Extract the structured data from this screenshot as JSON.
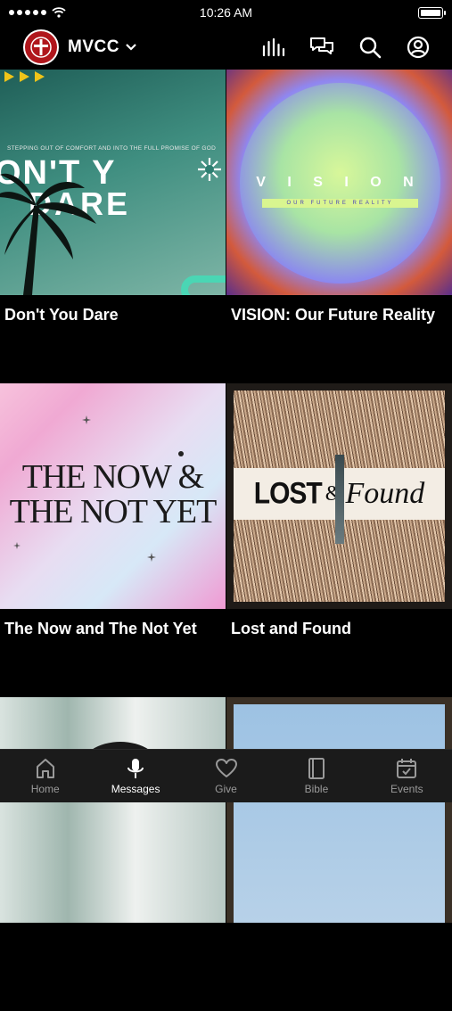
{
  "status_bar": {
    "time": "10:26 AM"
  },
  "header": {
    "title": "MVCC"
  },
  "messages": [
    {
      "title": "Don't You Dare",
      "art_top": "STEPPING OUT OF COMFORT AND INTO THE FULL PROMISE OF GOD",
      "art_line1": "ON'T Y",
      "art_line2": "DARE"
    },
    {
      "title": "VISION: Our Future Reality",
      "art_main": "V I S I O N",
      "art_sub": "OUR FUTURE REALITY"
    },
    {
      "title": "The Now and The Not Yet",
      "art_line1": "THE NOW &",
      "art_line2": "THE NOT YET"
    },
    {
      "title": "Lost and Found",
      "art_left": "LOST",
      "art_amp": "&",
      "art_right": "Found"
    }
  ],
  "tabs": [
    {
      "label": "Home",
      "icon": "home-icon"
    },
    {
      "label": "Messages",
      "icon": "microphone-icon"
    },
    {
      "label": "Give",
      "icon": "heart-icon"
    },
    {
      "label": "Bible",
      "icon": "book-icon"
    },
    {
      "label": "Events",
      "icon": "calendar-icon"
    }
  ],
  "active_tab": "Messages",
  "colors": {
    "background": "#000000",
    "tabbar": "#1b1b1b",
    "logo_red": "#b0161c"
  }
}
